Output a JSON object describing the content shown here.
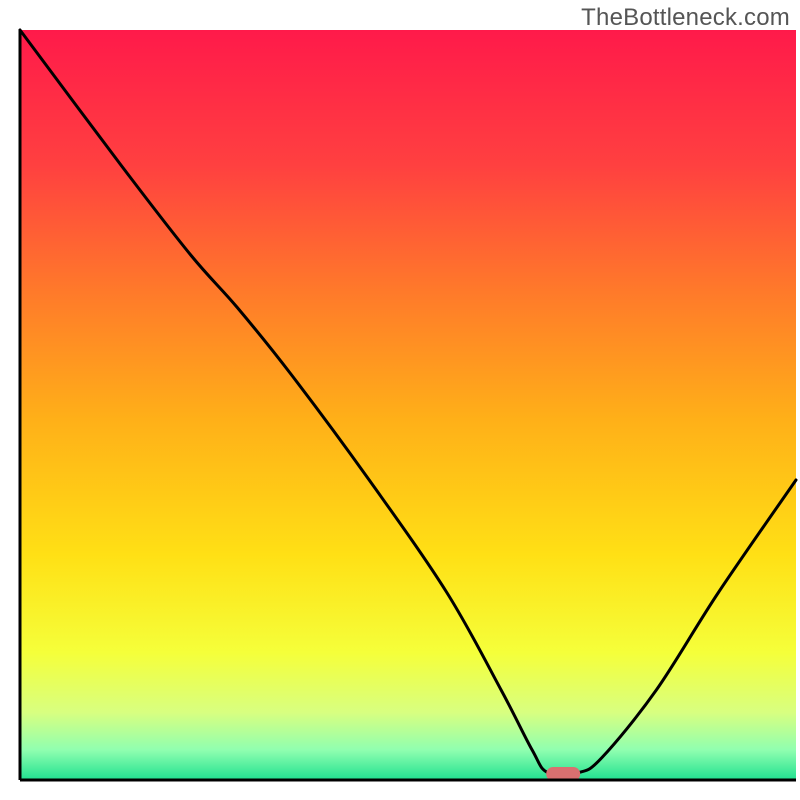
{
  "watermark": "TheBottleneck.com",
  "chart_data": {
    "type": "line",
    "title": "",
    "xlabel": "",
    "ylabel": "",
    "xlim": [
      0,
      100
    ],
    "ylim": [
      0,
      100
    ],
    "grid": false,
    "legend": false,
    "background_gradient_stops": [
      {
        "offset": 0.0,
        "color": "#ff1a4a"
      },
      {
        "offset": 0.18,
        "color": "#ff4040"
      },
      {
        "offset": 0.35,
        "color": "#ff7a2a"
      },
      {
        "offset": 0.52,
        "color": "#ffb018"
      },
      {
        "offset": 0.7,
        "color": "#ffe015"
      },
      {
        "offset": 0.83,
        "color": "#f5ff3a"
      },
      {
        "offset": 0.91,
        "color": "#d8ff80"
      },
      {
        "offset": 0.96,
        "color": "#90ffb0"
      },
      {
        "offset": 1.0,
        "color": "#20e090"
      }
    ],
    "curve_points": [
      {
        "x": 0,
        "y": 100
      },
      {
        "x": 13,
        "y": 82
      },
      {
        "x": 22,
        "y": 70
      },
      {
        "x": 28,
        "y": 63
      },
      {
        "x": 35,
        "y": 54
      },
      {
        "x": 45,
        "y": 40
      },
      {
        "x": 55,
        "y": 25
      },
      {
        "x": 62,
        "y": 12
      },
      {
        "x": 66,
        "y": 4
      },
      {
        "x": 68,
        "y": 1
      },
      {
        "x": 72,
        "y": 1
      },
      {
        "x": 75,
        "y": 3
      },
      {
        "x": 82,
        "y": 12
      },
      {
        "x": 90,
        "y": 25
      },
      {
        "x": 100,
        "y": 40
      }
    ],
    "marker": {
      "x": 70,
      "y": 0.8,
      "color": "#d97070"
    },
    "axis_stroke": "#000000",
    "axis_width": 3,
    "plot_area_fraction": 0.96
  }
}
